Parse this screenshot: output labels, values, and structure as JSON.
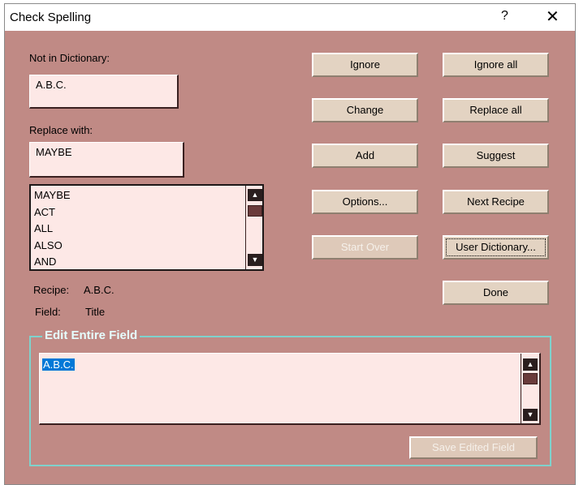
{
  "window": {
    "title": "Check Spelling",
    "help": "?",
    "close": "✕"
  },
  "labels": {
    "not_in_dictionary": "Not in Dictionary:",
    "replace_with": "Replace with:",
    "recipe_label": "Recipe:",
    "recipe_value": "A.B.C.",
    "field_label": "Field:",
    "field_value": "Title"
  },
  "fields": {
    "not_in_dictionary_value": "A.B.C.",
    "replace_with_value": "MAYBE"
  },
  "suggestions": [
    "MAYBE",
    "ACT",
    "ALL",
    "ALSO",
    "AND"
  ],
  "buttons": {
    "ignore": "Ignore",
    "ignore_all": "Ignore all",
    "change": "Change",
    "replace_all": "Replace all",
    "add": "Add",
    "suggest": "Suggest",
    "options": "Options...",
    "next_recipe": "Next Recipe",
    "start_over": "Start Over",
    "user_dictionary": "User Dictionary...",
    "done": "Done",
    "save_edited_field": "Save Edited Field"
  },
  "edit_group": {
    "title": "Edit Entire Field",
    "value": "A.B.C."
  },
  "icons": {
    "scroll_up": "▲",
    "scroll_down": "▼"
  }
}
